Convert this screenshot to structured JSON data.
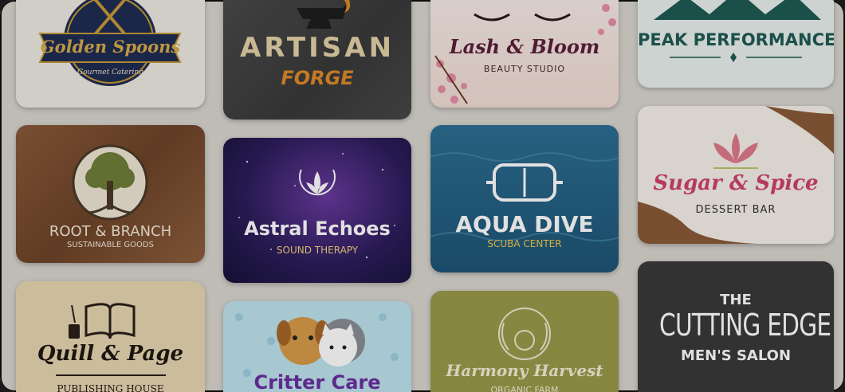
{
  "cards": [
    {
      "title": "Golden Spoons",
      "subtitle": "Gourmet Catering"
    },
    {
      "title": "ARTISAN",
      "subtitle": "FORGE"
    },
    {
      "title": "Lash & Bloom",
      "subtitle": "BEAUTY STUDIO"
    },
    {
      "title": "PEAK PERFORMANCE"
    },
    {
      "title": "ROOT & BRANCH",
      "subtitle": "SUSTAINABLE GOODS"
    },
    {
      "title": "Astral Echoes",
      "subtitle": "SOUND THERAPY"
    },
    {
      "title": "AQUA DIVE",
      "subtitle": "SCUBA CENTER"
    },
    {
      "title": "Sugar & Spice",
      "subtitle": "DESSERT BAR"
    },
    {
      "title": "Quill & Page",
      "subtitle": "PUBLISHING HOUSE"
    },
    {
      "title": "Critter Care"
    },
    {
      "title": "Harmony Harvest",
      "subtitle": "ORGANIC FARM"
    },
    {
      "title_top": "THE",
      "title": "CUTTING EDGE",
      "subtitle": "MEN'S SALON"
    }
  ],
  "colors": {
    "background": "#d9d6cf",
    "golden_navy": "#1f2d52",
    "golden_gold": "#c79a3a",
    "artisan_orange": "#e08a2a",
    "lash_plum": "#5a1f3a",
    "peak_teal": "#1f5a55",
    "astral_purple": "#2c1d5c",
    "aqua_blue": "#1d5576",
    "aqua_yellow": "#f2c64a",
    "sugar_pink": "#d0436a",
    "cutting_dark": "#3a3a3a"
  }
}
